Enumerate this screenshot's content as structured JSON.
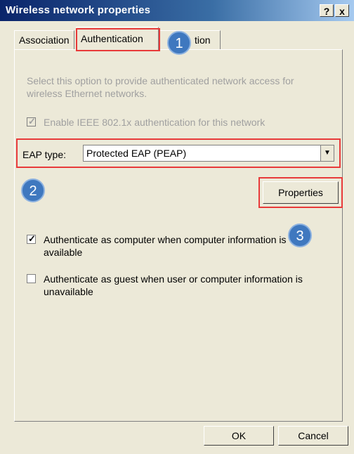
{
  "window": {
    "title": "Wireless network properties",
    "help_glyph": "?",
    "close_glyph": "x"
  },
  "tabs": [
    {
      "label": "Association"
    },
    {
      "label": "Authentication",
      "selected": true
    },
    {
      "label": "Connection"
    }
  ],
  "hidden_tab_fragment": "tion",
  "description": "Select this option to provide authenticated network access for wireless Ethernet networks.",
  "ieee": {
    "label": "Enable IEEE 802.1x authentication for this network",
    "checked": true,
    "disabled": true
  },
  "eap": {
    "label": "EAP type:",
    "value": "Protected EAP (PEAP)"
  },
  "properties_button": "Properties",
  "options": [
    {
      "label": "Authenticate as computer when computer information is available",
      "checked": true
    },
    {
      "label": "Authenticate as guest when user or computer information is unavailable",
      "checked": false
    }
  ],
  "ok_label": "OK",
  "cancel_label": "Cancel",
  "badges": [
    "1",
    "2",
    "3"
  ],
  "colors": {
    "highlight": "#e83a3a",
    "badge": "#3f78bf",
    "titlebar": "#0a246a"
  }
}
